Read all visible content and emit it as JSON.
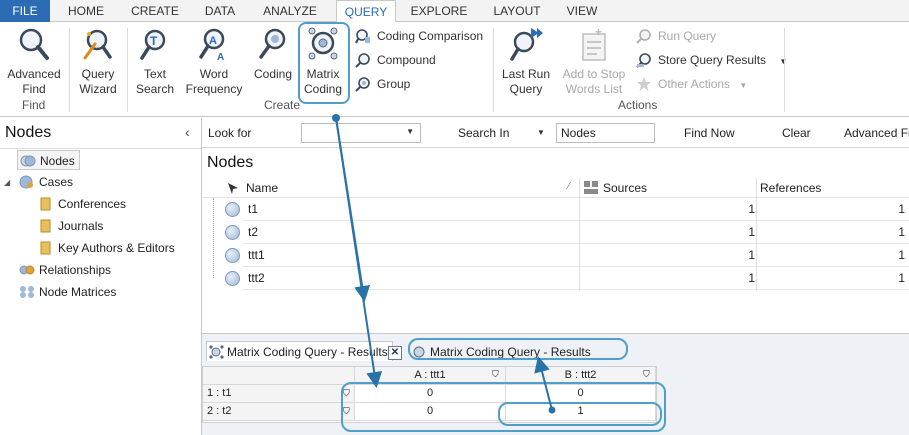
{
  "tabs": [
    "FILE",
    "HOME",
    "CREATE",
    "DATA",
    "ANALYZE",
    "QUERY",
    "EXPLORE",
    "LAYOUT",
    "VIEW"
  ],
  "active_tab": "QUERY",
  "ribbon": {
    "find_group": {
      "label": "Find",
      "advanced_find": [
        "Advanced",
        "Find"
      ]
    },
    "create_group": {
      "label": "Create",
      "query_wizard": [
        "Query",
        "Wizard"
      ],
      "text_search": [
        "Text",
        "Search"
      ],
      "word_frequency": [
        "Word",
        "Frequency"
      ],
      "coding": "Coding",
      "matrix_coding": [
        "Matrix",
        "Coding"
      ],
      "coding_comparison": "Coding Comparison",
      "compound": "Compound",
      "group": "Group"
    },
    "actions_group": {
      "label": "Actions",
      "last_run_query": [
        "Last Run",
        "Query"
      ],
      "add_to_stop_words": [
        "Add to Stop",
        "Words List"
      ],
      "run_query": "Run Query",
      "store_query_results": "Store Query Results",
      "other_actions": "Other Actions"
    }
  },
  "nav": {
    "title": "Nodes",
    "items": [
      "Nodes",
      "Cases",
      "Conferences",
      "Journals",
      "Key Authors & Editors",
      "Relationships",
      "Node Matrices"
    ]
  },
  "findbar": {
    "look_for": "Look for",
    "look_for_value": "",
    "search_in": "Search In",
    "search_in_value": "Nodes",
    "find_now": "Find Now",
    "clear": "Clear",
    "advanced_find": "Advanced Fi"
  },
  "list": {
    "title": "Nodes",
    "columns": [
      "Name",
      "Sources",
      "References"
    ],
    "rows": [
      {
        "name": "t1",
        "sources": "1",
        "references": "1"
      },
      {
        "name": "t2",
        "sources": "1",
        "references": "1"
      },
      {
        "name": "ttt1",
        "sources": "1",
        "references": "1"
      },
      {
        "name": "ttt2",
        "sources": "1",
        "references": "1"
      }
    ]
  },
  "results": {
    "tab_label": "Matrix Coding Query - Results",
    "tab_label_2": "Matrix Coding Query - Results",
    "columns": [
      "A : ttt1",
      "B : ttt2"
    ],
    "rows": [
      {
        "label": "1 : t1",
        "values": [
          "0",
          "0"
        ]
      },
      {
        "label": "2 : t2",
        "values": [
          "0",
          "1"
        ]
      }
    ]
  },
  "colors": {
    "accent": "#2b6cb5",
    "highlight": "#4f9fca"
  }
}
